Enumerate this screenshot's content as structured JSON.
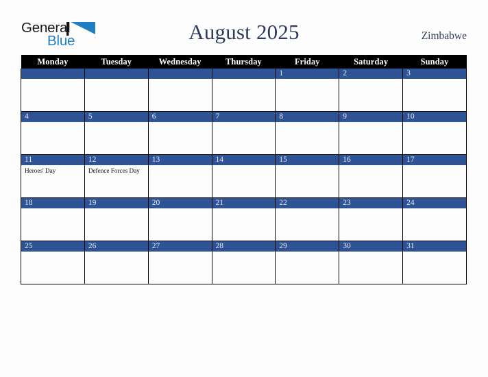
{
  "logo": {
    "word_one": "General",
    "word_two": "Blue",
    "mark": "triangle-logo-icon",
    "accent_color": "#1f7fc2",
    "text_color": "#1c1c1c"
  },
  "header": {
    "title": "August 2025",
    "country": "Zimbabwe",
    "title_color": "#2b3a5e"
  },
  "calendar": {
    "header_bg": "#000000",
    "header_text_color": "#ffffff",
    "daybar_bg": "#2f5496",
    "daybar_text_color": "#e8eaf0",
    "weekdays": [
      "Monday",
      "Tuesday",
      "Wednesday",
      "Thursday",
      "Friday",
      "Saturday",
      "Sunday"
    ],
    "weeks": [
      [
        {
          "date": "",
          "events": []
        },
        {
          "date": "",
          "events": []
        },
        {
          "date": "",
          "events": []
        },
        {
          "date": "",
          "events": []
        },
        {
          "date": "1",
          "events": []
        },
        {
          "date": "2",
          "events": []
        },
        {
          "date": "3",
          "events": []
        }
      ],
      [
        {
          "date": "4",
          "events": []
        },
        {
          "date": "5",
          "events": []
        },
        {
          "date": "6",
          "events": []
        },
        {
          "date": "7",
          "events": []
        },
        {
          "date": "8",
          "events": []
        },
        {
          "date": "9",
          "events": []
        },
        {
          "date": "10",
          "events": []
        }
      ],
      [
        {
          "date": "11",
          "events": [
            "Heroes' Day"
          ]
        },
        {
          "date": "12",
          "events": [
            "Defence Forces Day"
          ]
        },
        {
          "date": "13",
          "events": []
        },
        {
          "date": "14",
          "events": []
        },
        {
          "date": "15",
          "events": []
        },
        {
          "date": "16",
          "events": []
        },
        {
          "date": "17",
          "events": []
        }
      ],
      [
        {
          "date": "18",
          "events": []
        },
        {
          "date": "19",
          "events": []
        },
        {
          "date": "20",
          "events": []
        },
        {
          "date": "21",
          "events": []
        },
        {
          "date": "22",
          "events": []
        },
        {
          "date": "23",
          "events": []
        },
        {
          "date": "24",
          "events": []
        }
      ],
      [
        {
          "date": "25",
          "events": []
        },
        {
          "date": "26",
          "events": []
        },
        {
          "date": "27",
          "events": []
        },
        {
          "date": "28",
          "events": []
        },
        {
          "date": "29",
          "events": []
        },
        {
          "date": "30",
          "events": []
        },
        {
          "date": "31",
          "events": []
        }
      ]
    ]
  }
}
